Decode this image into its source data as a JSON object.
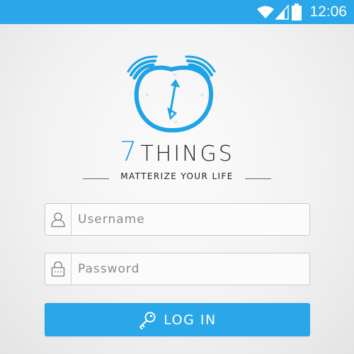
{
  "status_bar": {
    "time": "12:06",
    "icons": [
      "wifi-icon",
      "signal-icon",
      "battery-icon"
    ],
    "background_color": "#29a7e8"
  },
  "logo": {
    "icon": "alarm-clock-icon",
    "brand_number": "7",
    "brand_name": "THINGS",
    "tagline": "MATTERIZE YOUR LIFE",
    "accent_color": "#1ea3e6"
  },
  "login_form": {
    "username": {
      "placeholder": "Username",
      "value": "",
      "icon": "user-icon"
    },
    "password": {
      "placeholder": "Password",
      "value": "",
      "icon": "lock-icon"
    },
    "login_button": {
      "label": "LOG IN",
      "icon": "key-icon",
      "color": "#29a7e8"
    }
  }
}
